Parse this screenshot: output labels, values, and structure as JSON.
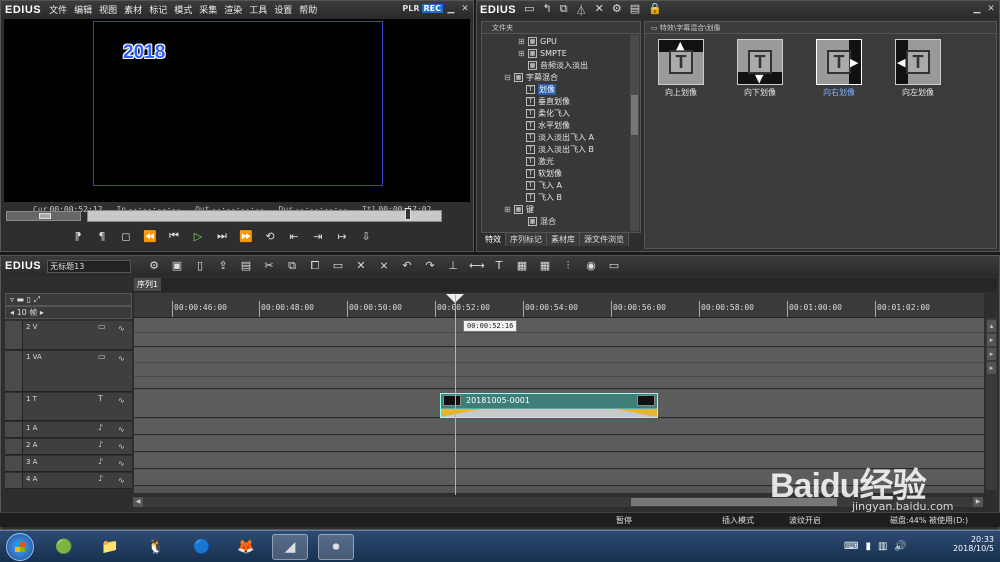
{
  "preview": {
    "logo": "EDIUS",
    "menu": [
      "文件",
      "编辑",
      "视图",
      "素材",
      "标记",
      "模式",
      "采集",
      "渲染",
      "工具",
      "设置",
      "帮助"
    ],
    "plr": "PLR",
    "rec": "REC",
    "overlay_title": "2018",
    "timecodes": [
      {
        "label": "Cur",
        "value": "00:00:52:12"
      },
      {
        "label": "In",
        "value": "--:--:--:--"
      },
      {
        "label": "Out",
        "value": "--:--:--:--"
      },
      {
        "label": "Dur",
        "value": "--:--:--:--"
      },
      {
        "label": "Ttl",
        "value": "00:00:57:02"
      }
    ]
  },
  "effects": {
    "logo": "EDIUS",
    "tree_header": "文件夹",
    "tree": [
      {
        "label": "GPU",
        "icon": "folder-icon"
      },
      {
        "label": "SMPTE",
        "icon": "folder-icon"
      },
      {
        "label": "音频淡入淡出",
        "icon": "folder-icon"
      },
      {
        "label": "字幕混合",
        "icon": "folder-icon"
      },
      {
        "label": "划像",
        "icon": "title-effect-icon"
      },
      {
        "label": "垂直划像",
        "icon": "title-effect-icon"
      },
      {
        "label": "柔化飞入",
        "icon": "title-effect-icon"
      },
      {
        "label": "水平划像",
        "icon": "title-effect-icon"
      },
      {
        "label": "淡入淡出飞入 A",
        "icon": "title-effect-icon"
      },
      {
        "label": "淡入淡出飞入 B",
        "icon": "title-effect-icon"
      },
      {
        "label": "激光",
        "icon": "title-effect-icon"
      },
      {
        "label": "软划像",
        "icon": "title-effect-icon"
      },
      {
        "label": "飞入 A",
        "icon": "title-effect-icon"
      },
      {
        "label": "飞入 B",
        "icon": "title-effect-icon"
      },
      {
        "label": "键",
        "icon": "folder-icon"
      },
      {
        "label": "混合",
        "icon": "folder-icon"
      }
    ],
    "tabs": [
      "特效",
      "序列标记",
      "素材库",
      "源文件浏览"
    ],
    "path": "特效\\字幕混合\\划像",
    "items": [
      {
        "label": "向上划像"
      },
      {
        "label": "向下划像"
      },
      {
        "label": "向右划像"
      },
      {
        "label": "向左划像"
      }
    ]
  },
  "timeline": {
    "logo": "EDIUS",
    "project_name": "无标题13",
    "sequence_tab": "序列1",
    "scale_label": "10 帧",
    "ruler_labels": [
      "00:00:46:00",
      "00:00:48:00",
      "00:00:50:00",
      "00:00:52:00",
      "00:00:54:00",
      "00:00:56:00",
      "00:00:58:00",
      "00:01:00:00",
      "00:01:02:00"
    ],
    "tracks": [
      {
        "name": "2 V"
      },
      {
        "name": "1 VA"
      },
      {
        "name": "1 T"
      },
      {
        "name": "1 A"
      },
      {
        "name": "2 A"
      },
      {
        "name": "3 A"
      },
      {
        "name": "4 A"
      }
    ],
    "clip_name": "20181005-0001",
    "tooltip": "00:00:52:16",
    "status": {
      "state": "暂停",
      "mode": "插入模式",
      "ripple": "波纹开启",
      "disk": "磁盘:44% 被使用(D:)"
    }
  },
  "taskbar": {
    "time": "20:33",
    "date": "2018/10/5"
  },
  "watermark": {
    "brand": "Baidu经验",
    "url": "jingyan.baidu.com"
  }
}
